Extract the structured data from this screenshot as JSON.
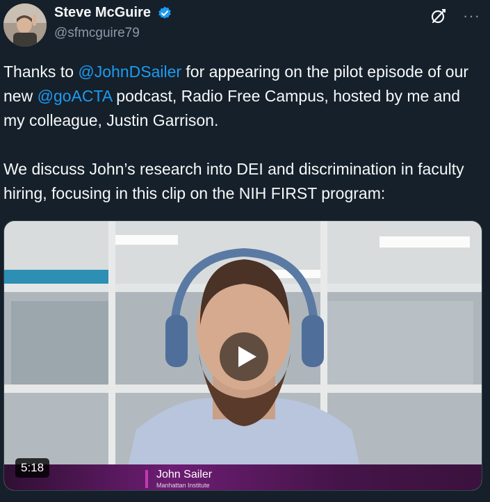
{
  "author": {
    "display_name": "Steve McGuire",
    "handle": "@sfmcguire79",
    "verified": true
  },
  "header_icons": [
    "grok-icon",
    "more-icon"
  ],
  "more_label": "···",
  "tweet": {
    "p1_before": "Thanks to ",
    "mention1": "@JohnDSailer",
    "p1_middle": " for appearing on the pilot episode of our new ",
    "mention2": "@goACTA",
    "p1_after": " podcast, Radio Free Campus, hosted by me and my colleague, Justin Garrison.",
    "p2": "We discuss John’s research into DEI and discrimination in faculty hiring, focusing in this clip on the NIH FIRST program:"
  },
  "video": {
    "duration": "5:18",
    "lower_third_name": "John Sailer",
    "lower_third_org": "Manhattan Institute"
  },
  "colors": {
    "background": "#15202b",
    "accent": "#1d9bf0",
    "muted": "#8b98a5"
  }
}
